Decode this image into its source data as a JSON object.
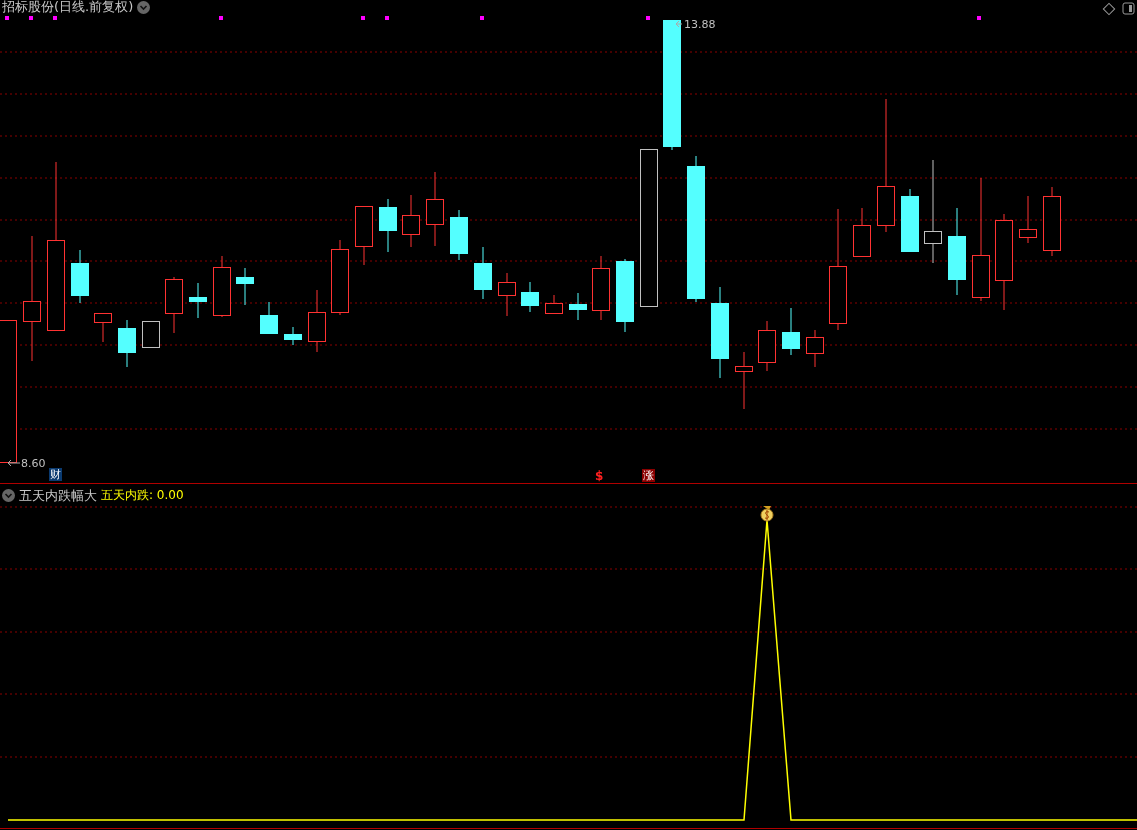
{
  "price_panel": {
    "title": "招标股份(日线.前复权)",
    "high_label": "13.88",
    "low_label": "8.60",
    "markers": [
      {
        "kind": "caption",
        "text": "财"
      },
      {
        "kind": "dollar",
        "text": "$"
      },
      {
        "kind": "boxed",
        "text": "涨"
      }
    ]
  },
  "indicator_panel": {
    "name": "五天内跌幅大",
    "value_label": "五天内跌: 0.00"
  }
}
